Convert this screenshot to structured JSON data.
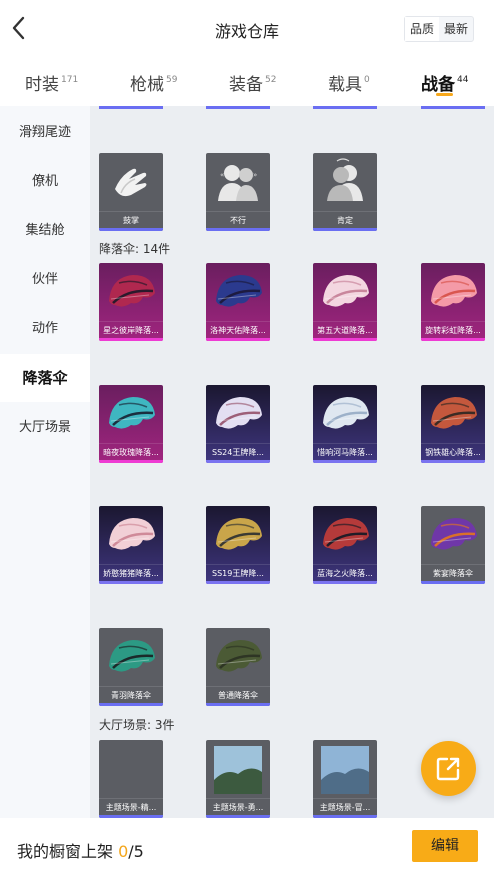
{
  "header": {
    "title": "游戏仓库",
    "sort_quality": "品质",
    "sort_latest": "最新"
  },
  "tabs": [
    {
      "label": "时装",
      "count": "171"
    },
    {
      "label": "枪械",
      "count": "59"
    },
    {
      "label": "装备",
      "count": "52"
    },
    {
      "label": "载具",
      "count": "0"
    },
    {
      "label": "战备",
      "count": "44",
      "active": true
    }
  ],
  "sidebar": [
    {
      "label": "滑翔尾迹"
    },
    {
      "label": "僚机"
    },
    {
      "label": "集结舱"
    },
    {
      "label": "伙伴"
    },
    {
      "label": "动作"
    },
    {
      "label": "降落伞",
      "active": true
    },
    {
      "label": "大厅场景"
    }
  ],
  "actions": [
    {
      "name": "鼓掌"
    },
    {
      "name": "不行"
    },
    {
      "name": "肯定"
    }
  ],
  "parachute_section": {
    "label": "降落伞: 14件"
  },
  "parachutes": [
    {
      "name": "星之彼岸降落...",
      "rarity": "pink",
      "c1": "#b0284f",
      "c2": "#2a1a2c"
    },
    {
      "name": "洛神天佑降落...",
      "rarity": "pink",
      "c1": "#2b3a8e",
      "c2": "#1d1b40"
    },
    {
      "name": "第五大道降落...",
      "rarity": "pink",
      "c1": "#f3d6e0",
      "c2": "#c9869c"
    },
    {
      "name": "旋转彩虹降落...",
      "rarity": "pink",
      "c1": "#f49aa7",
      "c2": "#d9564f"
    },
    {
      "name": "暗夜玫瑰降落...",
      "rarity": "pink",
      "c1": "#3fb6c1",
      "c2": "#1b2f3f"
    },
    {
      "name": "SS24王牌降...",
      "rarity": "purple",
      "c1": "#e3dff2",
      "c2": "#9d5f78"
    },
    {
      "name": "惜响河马降落...",
      "rarity": "purple",
      "c1": "#dfe7f0",
      "c2": "#9db1c9"
    },
    {
      "name": "钢铁雄心降落...",
      "rarity": "purple",
      "c1": "#c4583d",
      "c2": "#3b2b24"
    },
    {
      "name": "娇憨猪猪降落...",
      "rarity": "purple",
      "c1": "#f1cfd6",
      "c2": "#cf8a99"
    },
    {
      "name": "SS19王牌降...",
      "rarity": "purple",
      "c1": "#c9a54a",
      "c2": "#3b3a33"
    },
    {
      "name": "蓝海之火降落...",
      "rarity": "purple",
      "c1": "#b53a3a",
      "c2": "#221c27"
    },
    {
      "name": "紫宴降落伞",
      "rarity": "gray",
      "c1": "#6f37a8",
      "c2": "#d9702a"
    },
    {
      "name": "青羽降落伞",
      "rarity": "gray",
      "c1": "#2c9a84",
      "c2": "#1b2a2a"
    },
    {
      "name": "普通降落伞",
      "rarity": "gray",
      "c1": "#4b5a35",
      "c2": "#2e3524"
    }
  ],
  "lobby_section": {
    "label": "大厅场景: 3件"
  },
  "lobby_scenes": [
    {
      "name": "主题场景-精...",
      "sky": "#5e6066",
      "ground": "#5e6066"
    },
    {
      "name": "主题场景-勇...",
      "sky": "#9ec2da",
      "ground": "#3c5a3f"
    },
    {
      "name": "主题场景-冒...",
      "sky": "#8fb4d6",
      "ground": "#4f6d88"
    }
  ],
  "bottom": {
    "label": "我的橱窗上架 ",
    "shelved": "0",
    "total": "/5",
    "edit_label": "编辑"
  }
}
